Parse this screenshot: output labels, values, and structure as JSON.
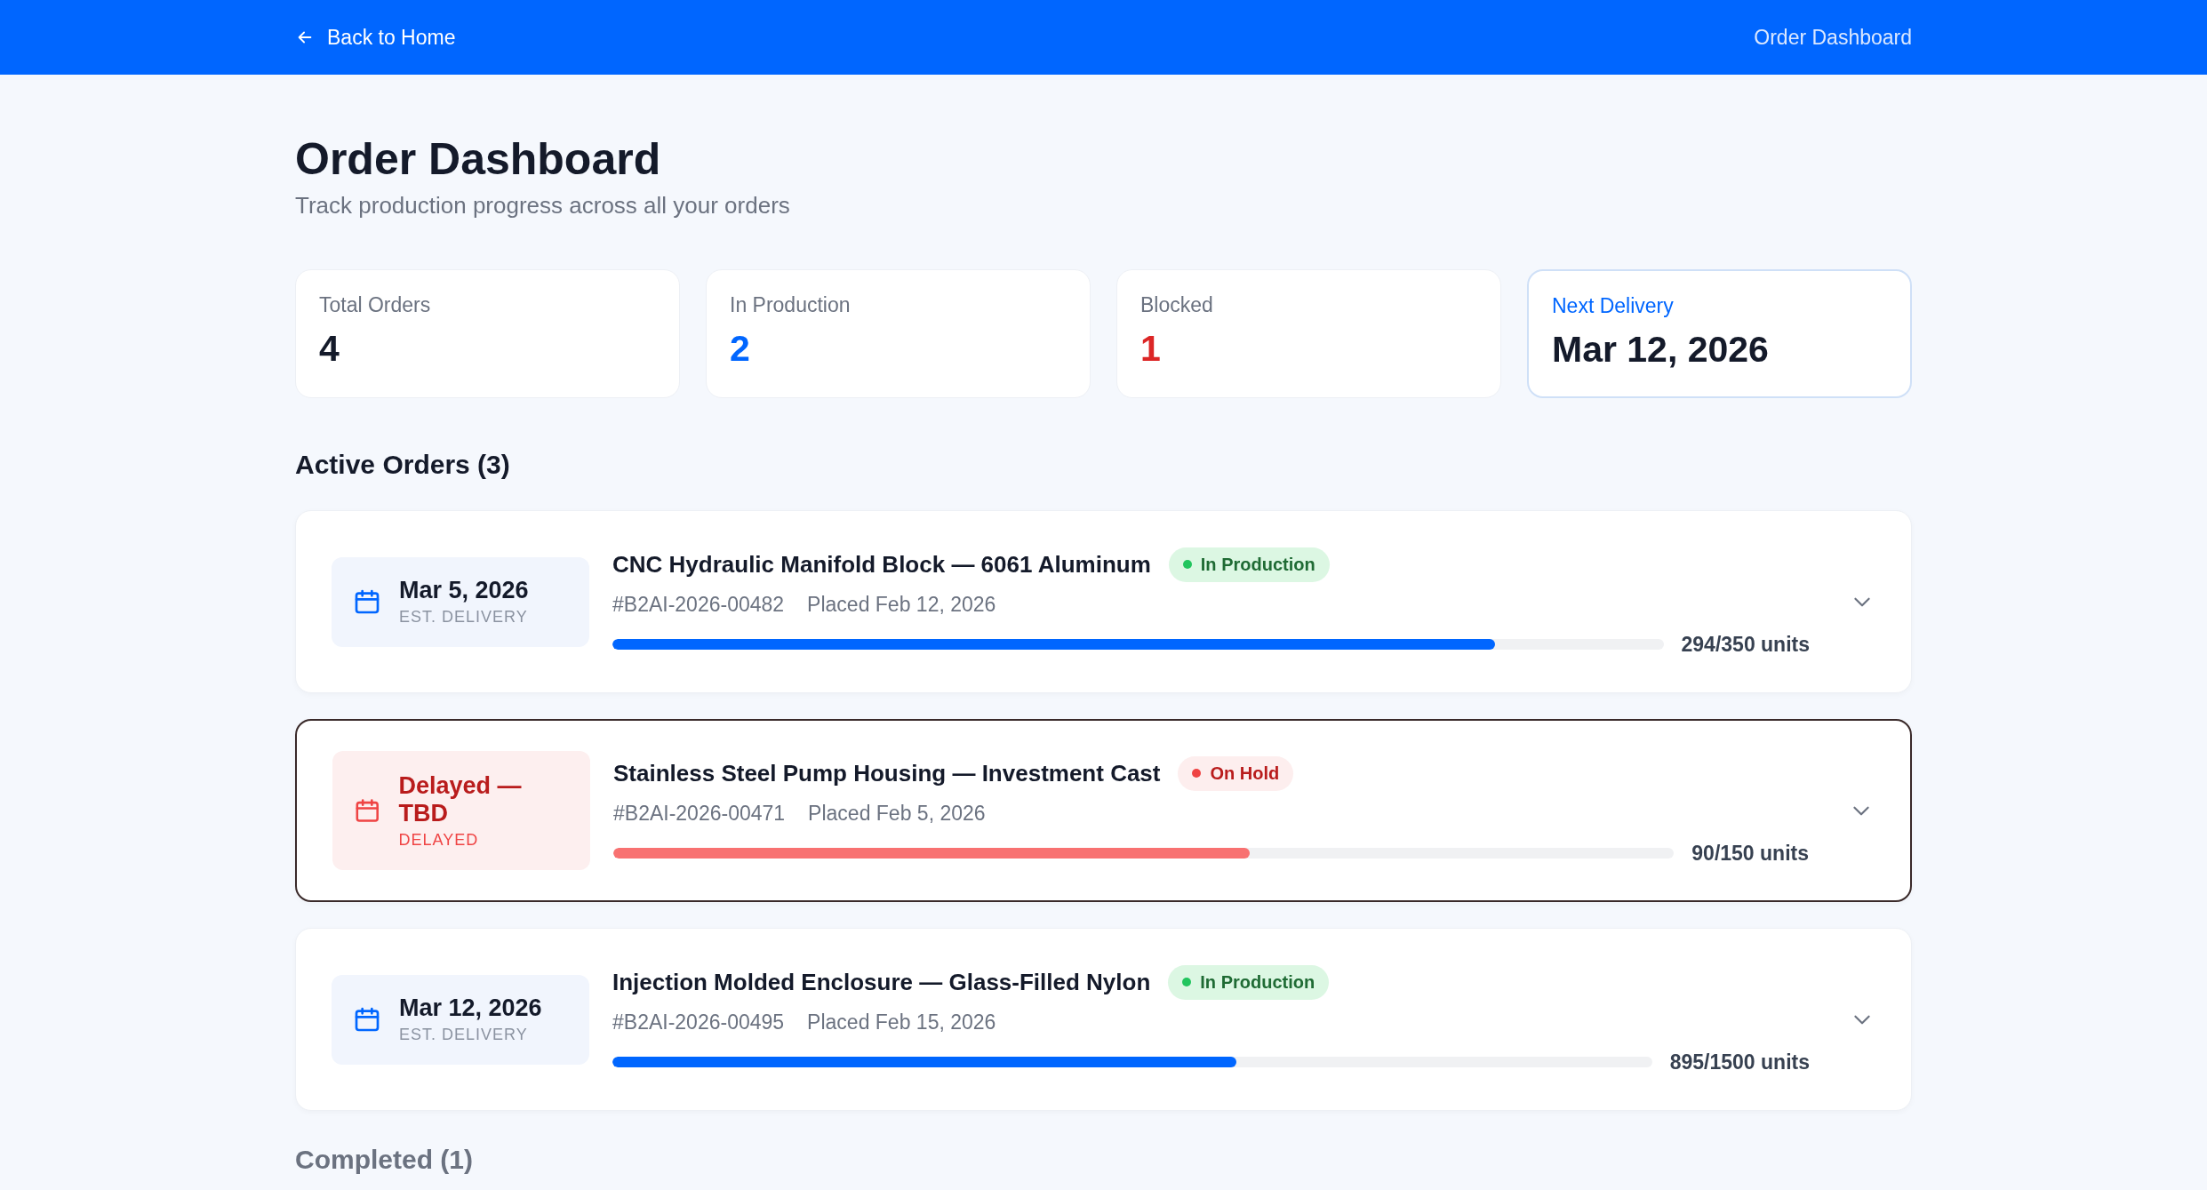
{
  "top_bar": {
    "back_link": "Back to Home",
    "page_label": "Order Dashboard"
  },
  "header": {
    "title": "Order Dashboard",
    "subtitle": "Track production progress across all your orders"
  },
  "stats": [
    {
      "label": "Total Orders",
      "value": "4",
      "kind": "plain"
    },
    {
      "label": "In Production",
      "value": "2",
      "kind": "blue"
    },
    {
      "label": "Blocked",
      "value": "1",
      "kind": "red"
    },
    {
      "label": "Next Delivery",
      "value": "Mar 12, 2026",
      "kind": "highlight"
    }
  ],
  "active_heading": "Active Orders (3)",
  "orders": [
    {
      "date": "Mar 5, 2026",
      "date_caption": "EST. DELIVERY",
      "delayed": false,
      "title": "CNC Hydraulic Manifold Block — 6061 Aluminum",
      "status": "In Production",
      "kind": "production",
      "order_id": "#B2AI-2026-00482",
      "placed": "Placed Feb 12, 2026",
      "level": 0.84,
      "units": "294/350 units",
      "selected": false
    },
    {
      "date": "Delayed — TBD",
      "date_caption": "DELAYED",
      "delayed": true,
      "title": "Stainless Steel Pump Housing — Investment Cast",
      "status": "On Hold",
      "kind": "hold",
      "order_id": "#B2AI-2026-00471",
      "placed": "Placed Feb 5, 2026",
      "level": 0.6,
      "units": "90/150 units",
      "selected": true
    },
    {
      "date": "Mar 12, 2026",
      "date_caption": "EST. DELIVERY",
      "delayed": false,
      "title": "Injection Molded Enclosure — Glass-Filled Nylon",
      "status": "In Production",
      "kind": "production",
      "order_id": "#B2AI-2026-00495",
      "placed": "Placed Feb 15, 2026",
      "level": 0.6,
      "units": "895/1500 units",
      "selected": false
    }
  ],
  "completed_heading": "Completed (1)"
}
